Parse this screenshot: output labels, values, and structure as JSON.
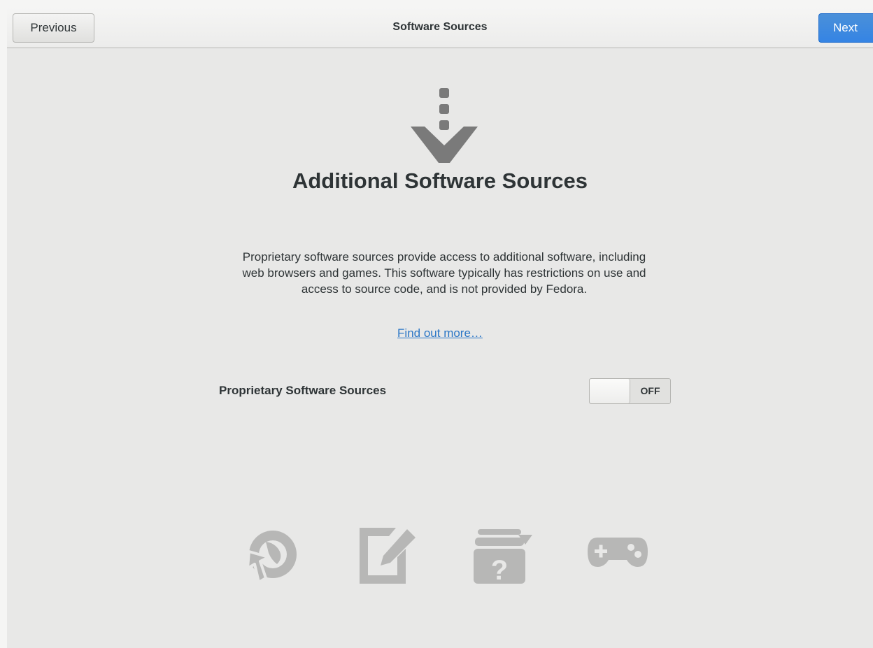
{
  "header": {
    "title": "Software Sources",
    "previous_label": "Previous",
    "next_label": "Next"
  },
  "main": {
    "title": "Additional Software Sources",
    "description": "Proprietary software sources provide access to additional software, including web browsers and games. This software typically has restrictions on use and access to source code, and is not provided by Fedora.",
    "link_label": "Find out more…",
    "toggle": {
      "label": "Proprietary Software Sources",
      "state_text": "OFF",
      "enabled": false
    }
  },
  "icons": {
    "hero": "download-arrow-icon",
    "features": [
      "web-browser-icon",
      "text-editor-icon",
      "help-package-icon",
      "gamepad-icon"
    ]
  },
  "colors": {
    "accent": "#3584e4",
    "link": "#2a76c6",
    "icon_gray": "#7a7a7a",
    "feature_icon_gray": "#b7b7b6"
  }
}
